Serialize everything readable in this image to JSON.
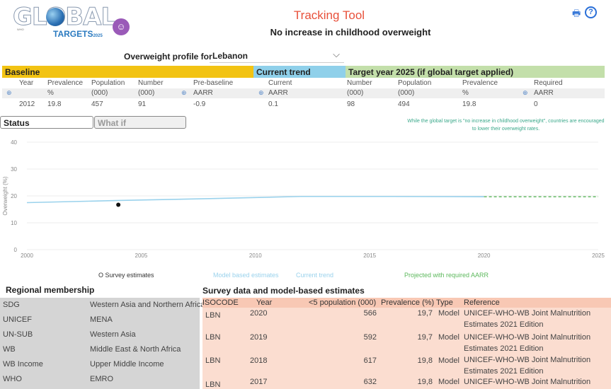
{
  "header": {
    "logo_word": "GLOBAL",
    "logo_sub": "WHO",
    "logo_targets": "TARGETS",
    "logo_year": "2025",
    "title": "Tracking Tool",
    "subtitle": "No increase in childhood overweight",
    "icons": [
      "print-icon",
      "help-icon"
    ],
    "help_glyph": "?"
  },
  "profile": {
    "label": "Overweight profile for",
    "country": "Lebanon"
  },
  "sections": {
    "baseline": "Baseline",
    "current": "Current trend",
    "target": "Target year 2025 (if global target applied)"
  },
  "summary": {
    "headers": [
      "Year",
      "Prevalence",
      "Population",
      "Number",
      "Pre-baseline",
      "Current",
      "Number",
      "Population",
      "Prevalence",
      "Required"
    ],
    "units": [
      "%",
      "(000)",
      "(000)",
      "AARR",
      "AARR",
      "(000)",
      "(000)",
      "%",
      "AARR"
    ],
    "values": [
      "2012",
      "19.8",
      "457",
      "91",
      "-0.9",
      "0.1",
      "98",
      "494",
      "19.8",
      "0"
    ]
  },
  "tabs": {
    "status": "Status",
    "whatif": "What if"
  },
  "note": "While the global target is \"no increase in childhood overweight\", countries are encouraged to lower their overweight rates.",
  "colors": {
    "baseline": "#f2c313",
    "current": "#8fd0ea",
    "target": "#c3dfaa",
    "model_line": "#9ad2ec",
    "projected": "#5cb85c",
    "title_red": "#e8503a"
  },
  "chart_data": {
    "type": "line",
    "ylabel": "Overweight (%)",
    "xlim": [
      2000,
      2025
    ],
    "ylim": [
      0,
      40
    ],
    "x_ticks": [
      "2000",
      "2005",
      "2010",
      "2015",
      "2020",
      "2025"
    ],
    "y_ticks": [
      "0",
      "10",
      "20",
      "30",
      "40"
    ],
    "grid": "horizontal",
    "series": [
      {
        "name": "Model based estimates",
        "x": [
          2000,
          2004,
          2008,
          2012,
          2016,
          2020
        ],
        "y": [
          17.5,
          18.3,
          19.0,
          19.8,
          19.8,
          19.7
        ]
      },
      {
        "name": "Current trend",
        "x": [
          2012,
          2020
        ],
        "y": [
          19.8,
          19.8
        ]
      },
      {
        "name": "Projected with required AARR",
        "x": [
          2020,
          2025
        ],
        "y": [
          19.7,
          19.7
        ]
      },
      {
        "name": "Survey estimates",
        "x": [
          2004
        ],
        "y": [
          16.7
        ]
      }
    ],
    "legend": [
      "O Survey estimates",
      "Model based estimates",
      "Current trend",
      "Projected with required AARR"
    ]
  },
  "regional": {
    "title": "Regional membership",
    "rows": [
      {
        "label": "SDG",
        "value": "Western Asia and Northern Africa"
      },
      {
        "label": "UNICEF",
        "value": "MENA"
      },
      {
        "label": "UN-SUB",
        "value": "Western Asia"
      },
      {
        "label": "WB",
        "value": "Middle East & North Africa"
      },
      {
        "label": "WB Income",
        "value": "Upper Middle Income"
      },
      {
        "label": "WHO",
        "value": "EMRO"
      }
    ]
  },
  "survey": {
    "title": "Survey data and model-based estimates",
    "headers": [
      "ISOCODE",
      "Year",
      "<5 population (000)",
      "Prevalence (%)",
      "Type",
      "Reference"
    ],
    "rows": [
      {
        "iso": "LBN",
        "year": "2020",
        "pop": "566",
        "prev": "19,7",
        "type": "Model",
        "ref1": "UNICEF-WHO-WB Joint Malnutrition",
        "ref2": "Estimates 2021 Edition"
      },
      {
        "iso": "LBN",
        "year": "2019",
        "pop": "592",
        "prev": "19,7",
        "type": "Model",
        "ref1": "UNICEF-WHO-WB Joint Malnutrition",
        "ref2": "Estimates 2021 Edition"
      },
      {
        "iso": "LBN",
        "year": "2018",
        "pop": "617",
        "prev": "19,8",
        "type": "Model",
        "ref1": "UNICEF-WHO-WB Joint Malnutrition",
        "ref2": "Estimates 2021 Edition"
      },
      {
        "iso": "LBN",
        "year": "2017",
        "pop": "632",
        "prev": "19,8",
        "type": "Model",
        "ref1": "UNICEF-WHO-WB Joint Malnutrition",
        "ref2": ""
      }
    ]
  }
}
